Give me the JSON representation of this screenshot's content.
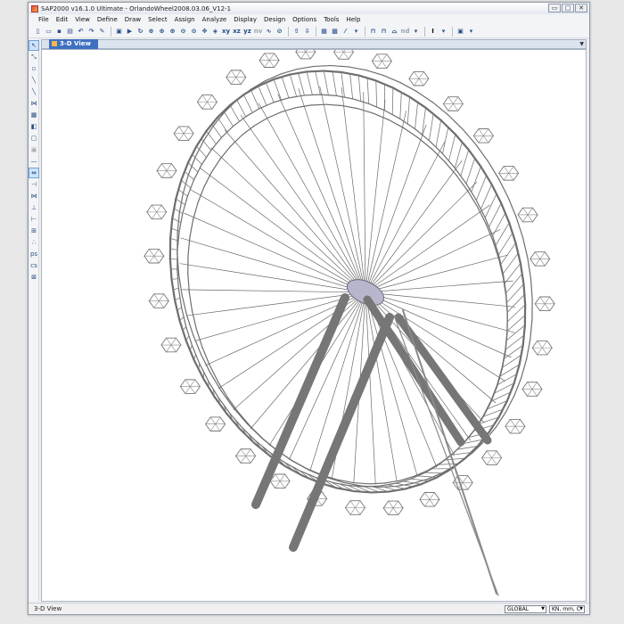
{
  "window": {
    "title": "SAP2000 v16.1.0 Ultimate - OrlandoWheel2008.03.06_V12-1",
    "controls": [
      "▭",
      "□",
      "✕"
    ]
  },
  "menubar": {
    "items": [
      "File",
      "Edit",
      "View",
      "Define",
      "Draw",
      "Select",
      "Assign",
      "Analyze",
      "Display",
      "Design",
      "Options",
      "Tools",
      "Help"
    ]
  },
  "toolbar": {
    "icons": [
      "new-file-icon",
      "open-folder-icon",
      "save-icon",
      "print-icon",
      "undo-icon",
      "redo-icon",
      "refresh-icon",
      "lock-icon",
      "run-analysis-icon",
      "rubberband-zoom-icon",
      "restore-view-icon",
      "zoom-in-icon",
      "zoom-out-icon",
      "pan-icon",
      "view-3d-icon",
      "view-xy-label",
      "view-xz-label",
      "view-yz-label",
      "view-nv-label",
      "rotate-icon",
      "up-arrow-icon",
      "down-arrow-icon",
      "show-undeformed-icon",
      "show-deformed-icon",
      "display-options-icon",
      "section-icon",
      "frame-icon",
      "shell-icon",
      "color-icon"
    ],
    "view_labels": {
      "xy": "xy",
      "xz": "xz",
      "yz": "yz",
      "nv": "nv"
    }
  },
  "document_tab": {
    "label": "3-D View"
  },
  "statusbar": {
    "text": "3-D View",
    "coord_system": "GLOBAL",
    "units": "KN, mm, C"
  },
  "model": {
    "name": "OrlandoWheel2008.03.06_V12-1",
    "view": "3-D View"
  }
}
